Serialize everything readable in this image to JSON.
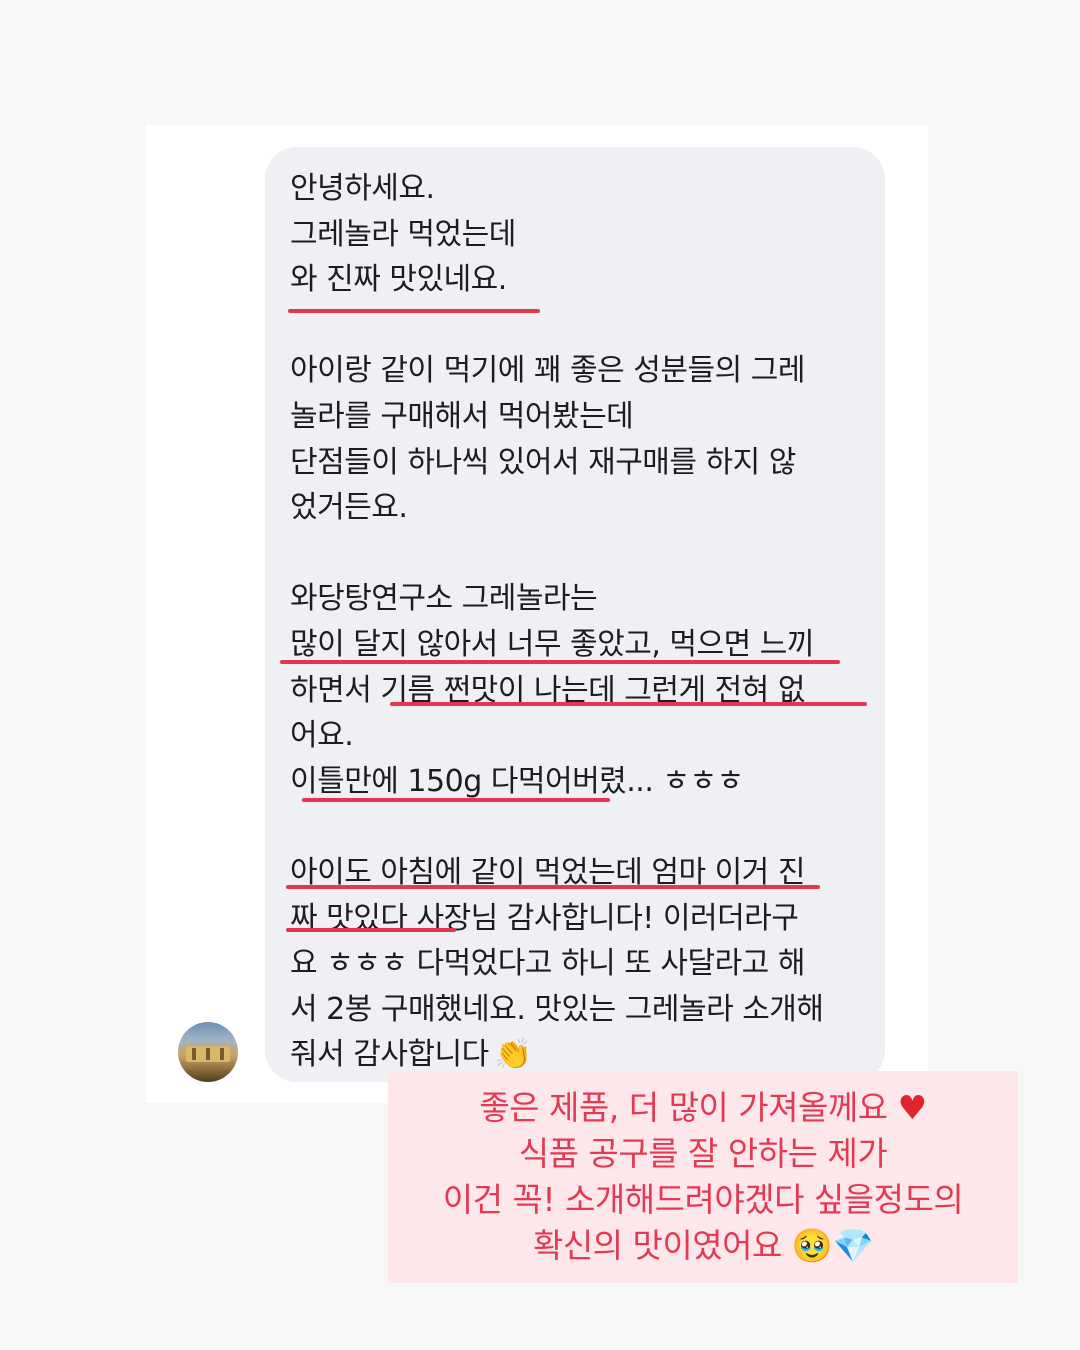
{
  "message": {
    "lines": [
      "안녕하세요.",
      "그레놀라 먹었는데",
      "와 진짜 맛있네요.",
      "",
      "아이랑 같이 먹기에 꽤 좋은 성분들의 그레",
      "놀라를 구매해서 먹어봤는데",
      "단점들이 하나씩 있어서 재구매를 하지 않",
      "었거든요.",
      "",
      "와당탕연구소 그레놀라는",
      "많이 달지 않아서 너무 좋았고, 먹으면 느끼",
      "하면서 기름 쩐맛이 나는데 그런게 전혀 없",
      "어요.",
      "이틀만에 150g 다먹어버렸... ㅎㅎㅎ",
      "",
      "아이도 아침에 같이 먹었는데 엄마 이거 진",
      "짜 맛있다 사장님 감사합니다! 이러더라구",
      "요 ㅎㅎㅎ 다먹었다고 하니 또 사달라고 해",
      "서 2봉 구매했네요. 맛있는 그레놀라 소개해",
      "줘서 감사합니다"
    ],
    "clap_emoji": "👏"
  },
  "note": {
    "line1": "좋은 제품, 더 많이 가져올께요",
    "heart": "♥",
    "line2": "식품 공구를 잘 안하는 제가",
    "line3": "이건 꼭! 소개해드려야겠다 싶을정도의",
    "line4": "확신의 맛이였어요",
    "emoji1": "🥹",
    "emoji2": "💎"
  },
  "colors": {
    "underline": "#e5364f",
    "note_text": "#e23a52",
    "note_bg": "#fde7ea",
    "bubble_bg": "#eff0f3"
  }
}
